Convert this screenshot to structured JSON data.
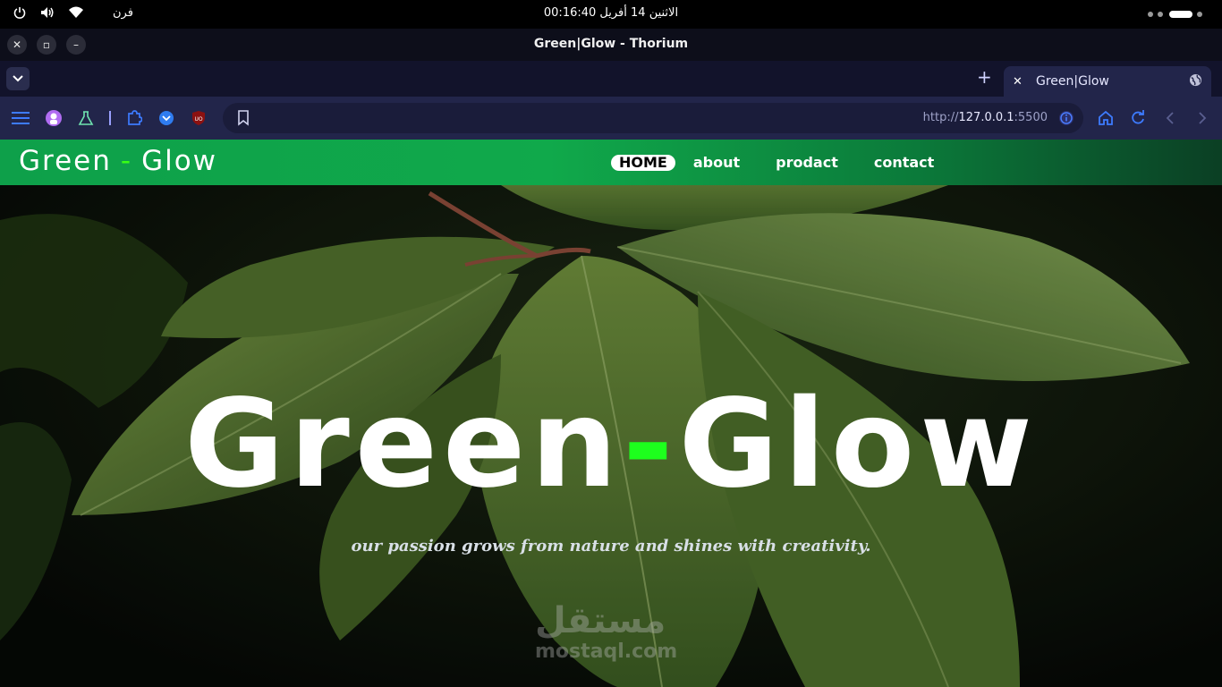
{
  "os": {
    "lang": "فرن",
    "clock": "الاثنين 14 أفريل  00:16:40"
  },
  "window": {
    "title": "Green|Glow - Thorium",
    "close": "✕",
    "restore": "▫",
    "minimize": "–"
  },
  "tabs": {
    "new_tab": "+",
    "items": [
      {
        "label": "Green|Glow",
        "close": "✕"
      }
    ]
  },
  "toolbar": {
    "url_scheme": "http://",
    "url_host": "127.0.0.1",
    "url_port": ":5500"
  },
  "site": {
    "logo_left": "Green",
    "logo_dash": "-",
    "logo_right": "Glow",
    "nav": [
      "HOME",
      "about",
      "prodact",
      "contact"
    ],
    "hero_title_left": "Green",
    "hero_title_dash": "-",
    "hero_title_right": "Glow",
    "hero_subtitle": "our passion grows from nature and shines with creativity.",
    "accent_color": "#39ff14",
    "nav_color": "#0ea04a"
  },
  "watermark": {
    "arabic": "مستقل",
    "latin": "mostaql.com"
  }
}
